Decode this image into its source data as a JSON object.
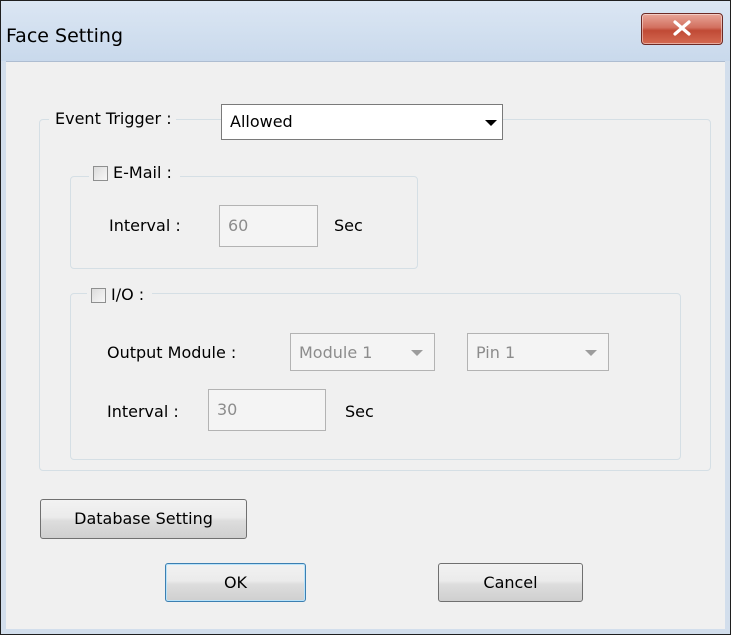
{
  "window": {
    "title": "Face Setting",
    "close_icon": "close-x-icon"
  },
  "event_trigger": {
    "label": "Event Trigger :",
    "selected": "Allowed"
  },
  "email": {
    "label": "E-Mail :",
    "checked": false,
    "interval_label": "Interval :",
    "interval_value": "60",
    "unit": "Sec"
  },
  "io": {
    "label": "I/O :",
    "checked": false,
    "output_module_label": "Output Module :",
    "module_selected": "Module 1",
    "pin_selected": "Pin 1",
    "interval_label": "Interval :",
    "interval_value": "30",
    "unit": "Sec"
  },
  "buttons": {
    "database": "Database Setting",
    "ok": "OK",
    "cancel": "Cancel"
  },
  "colors": {
    "close_button": "#c75050",
    "default_button_border": "#3c7fb1",
    "dialog_background": "#f0f0f0"
  }
}
